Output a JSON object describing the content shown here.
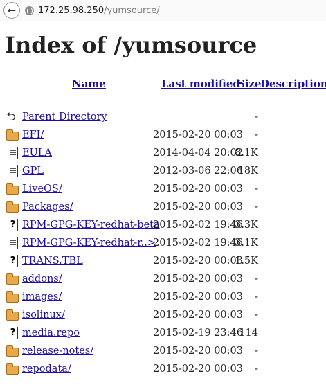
{
  "browser": {
    "url_host": "172.25.98.250",
    "url_path": "/yumsource/",
    "back_symbol": "←"
  },
  "page": {
    "title": "Index of /yumsource"
  },
  "columns": {
    "name": "Name",
    "last_modified": "Last modified",
    "size": "Size",
    "description": "Description"
  },
  "entries": [
    {
      "icon": "back",
      "name": "Parent Directory",
      "date": "",
      "size": "-"
    },
    {
      "icon": "folder",
      "name": "EFI/",
      "date": "2015-02-20 00:03",
      "size": "-"
    },
    {
      "icon": "doc",
      "name": "EULA",
      "date": "2014-04-04 20:02",
      "size": "8.1K"
    },
    {
      "icon": "doc",
      "name": "GPL",
      "date": "2012-03-06 22:06",
      "size": "18K"
    },
    {
      "icon": "folder",
      "name": "LiveOS/",
      "date": "2015-02-20 00:03",
      "size": "-"
    },
    {
      "icon": "folder",
      "name": "Packages/",
      "date": "2015-02-20 00:03",
      "size": "-"
    },
    {
      "icon": "unknown",
      "name": "RPM-GPG-KEY-redhat-beta",
      "date": "2015-02-02 19:46",
      "size": "3.3K"
    },
    {
      "icon": "doc",
      "name": "RPM-GPG-KEY-redhat-r..>",
      "date": "2015-02-02 19:46",
      "size": "3.1K"
    },
    {
      "icon": "unknown",
      "name": "TRANS.TBL",
      "date": "2015-02-20 00:03",
      "size": "1.5K"
    },
    {
      "icon": "folder",
      "name": "addons/",
      "date": "2015-02-20 00:03",
      "size": "-"
    },
    {
      "icon": "folder",
      "name": "images/",
      "date": "2015-02-20 00:03",
      "size": "-"
    },
    {
      "icon": "folder",
      "name": "isolinux/",
      "date": "2015-02-20 00:03",
      "size": "-"
    },
    {
      "icon": "unknown",
      "name": "media.repo",
      "date": "2015-02-19 23:46",
      "size": "114"
    },
    {
      "icon": "folder",
      "name": "release-notes/",
      "date": "2015-02-20 00:03",
      "size": "-"
    },
    {
      "icon": "folder",
      "name": "repodata/",
      "date": "2015-02-20 00:03",
      "size": "-"
    }
  ]
}
